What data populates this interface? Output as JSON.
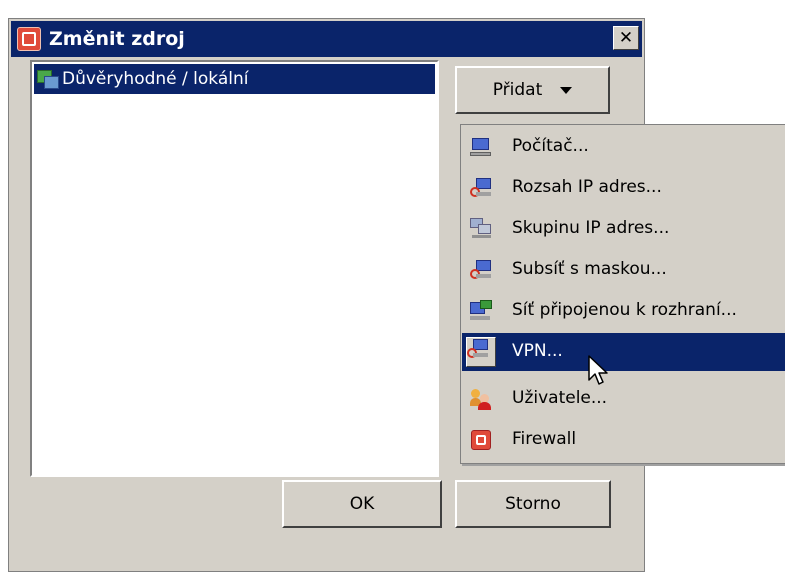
{
  "dialog": {
    "title": "Změnit zdroj",
    "close_label": "✕"
  },
  "source_list": {
    "items": [
      {
        "label": "Důvěryhodné / lokální",
        "icon": "network-icon",
        "selected": true
      }
    ]
  },
  "add_button": {
    "label": "Přidat"
  },
  "menu": {
    "items": [
      {
        "label": "Počítač...",
        "icon": "computer-icon"
      },
      {
        "label": "Rozsah IP adres...",
        "icon": "ip-range-icon"
      },
      {
        "label": "Skupinu IP adres...",
        "icon": "ip-group-icon"
      },
      {
        "label": "Subsíť s maskou...",
        "icon": "subnet-icon"
      },
      {
        "label": "Síť připojenou k rozhraní...",
        "icon": "interface-network-icon"
      },
      {
        "label": "VPN...",
        "icon": "vpn-icon",
        "highlighted": true
      },
      {
        "label": "Uživatele...",
        "icon": "users-icon"
      },
      {
        "label": "Firewall",
        "icon": "firewall-icon"
      }
    ]
  },
  "footer": {
    "ok_label": "OK",
    "cancel_label": "Storno"
  },
  "colors": {
    "titlebar": "#0a246a",
    "dialog_bg": "#d4d0c8",
    "highlight": "#0a246a"
  }
}
